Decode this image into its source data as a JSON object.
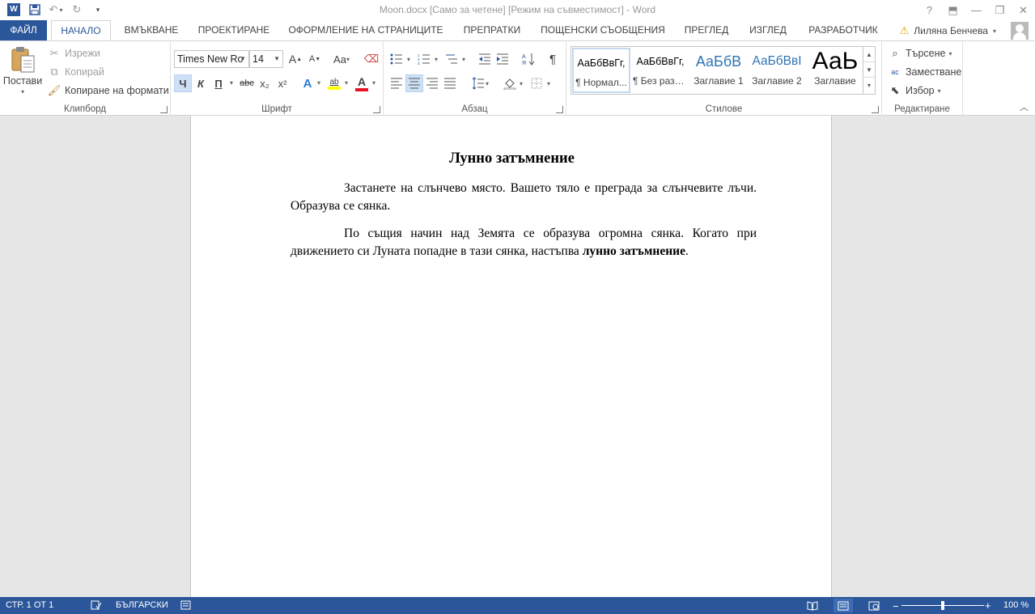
{
  "window": {
    "title": "Moon.docx [Само за четене] [Режим на съвместимост] - Word",
    "controls": {
      "help": "?",
      "ribbon_display": "⬒",
      "minimize": "—",
      "restore": "❐",
      "close": "✕"
    }
  },
  "qat": {
    "app_icon": "W",
    "save_icon": "save-icon",
    "undo": "↶",
    "redo": "↻",
    "customize": "▾"
  },
  "tabs": {
    "file": "ФАЙЛ",
    "items": [
      "НАЧАЛО",
      "ВМЪКВАНЕ",
      "ПРОЕКТИРАНЕ",
      "ОФОРМЛЕНИЕ НА СТРАНИЦИТЕ",
      "ПРЕПРАТКИ",
      "ПОЩЕНСКИ СЪОБЩЕНИЯ",
      "ПРЕГЛЕД",
      "ИЗГЛЕД",
      "РАЗРАБОТЧИК"
    ],
    "active_index": 0
  },
  "user": {
    "warning": "⚠",
    "name": "Лиляна Бенчева"
  },
  "ribbon": {
    "clipboard": {
      "label": "Клипборд",
      "paste": "Постави",
      "cut": "Изрежи",
      "copy": "Копирай",
      "format_painter": "Копиране на формати"
    },
    "font": {
      "label": "Шрифт",
      "font_name": "Times New Ro",
      "font_size": "14",
      "grow": "A",
      "shrink": "A",
      "change_case": "Aa",
      "bold": "Ч",
      "italic": "К",
      "underline": "П",
      "strike": "abc",
      "subscript": "x₂",
      "superscript": "x²",
      "text_effects": "A",
      "highlight": "ab",
      "font_color": "A"
    },
    "paragraph": {
      "label": "Абзац",
      "pilcrow": "¶"
    },
    "styles": {
      "label": "Стилове",
      "items": [
        {
          "sample": "АаБбВвГг,",
          "name": "¶ Нормал..."
        },
        {
          "sample": "АаБбВвГг,",
          "name": "¶ Без разр..."
        },
        {
          "sample": "АаБбВ",
          "name": "Заглавие 1"
        },
        {
          "sample": "АаБбВвІ",
          "name": "Заглавие 2"
        },
        {
          "sample": "АаЬ",
          "name": "Заглавие"
        }
      ],
      "selected_index": 0
    },
    "editing": {
      "label": "Редактиране",
      "find": "Търсене",
      "replace": "Заместване",
      "select": "Избор"
    }
  },
  "document": {
    "title": "Лунно затъмнение",
    "paragraphs": [
      {
        "lines": [
          "Застанете на слънчево място. Вашето тяло е преграда за слънчевите лъчи.",
          "Образува се сянка."
        ]
      },
      {
        "lines": [
          "По същия начин над Земята се образува огромна сянка. Когато при",
          "движението си Луната попадне в тази сянка, настъпва "
        ],
        "bold_tail": "лунно затъмнение",
        "tail": "."
      }
    ]
  },
  "status": {
    "page": "СТР. 1 ОТ 1",
    "language": "БЪЛГАРСКИ",
    "zoom": "100 %",
    "zoom_minus": "−",
    "zoom_plus": "+",
    "zoom_level_fraction": 0.5
  },
  "colors": {
    "accent": "#2b579a",
    "doc_background": "#e6e6e6",
    "font_color_bar": "#e81123",
    "highlight_bar": "#ffff00"
  }
}
